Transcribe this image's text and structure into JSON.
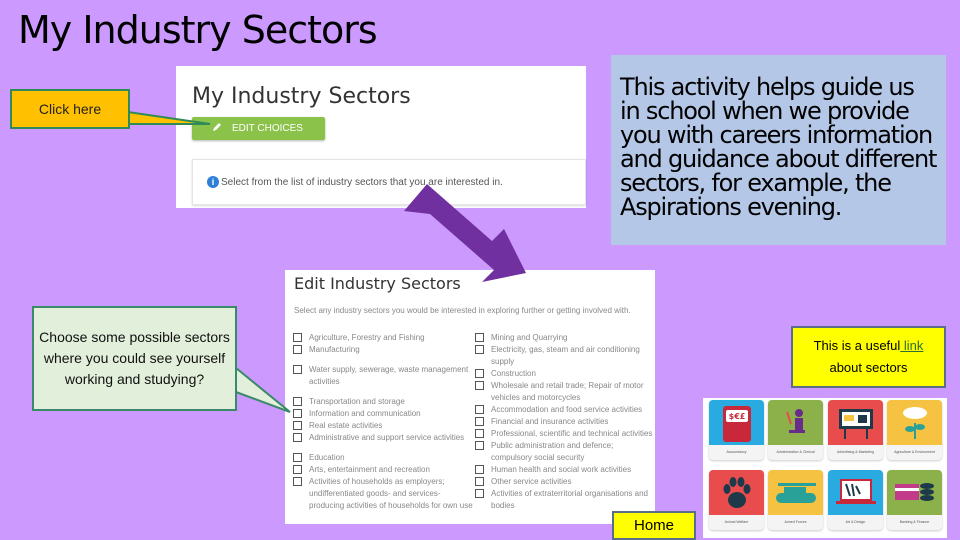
{
  "slide": {
    "title": "My Industry Sectors",
    "colors": {
      "background": "#cc99ff",
      "arrow": "#7030a0",
      "click_callout": "#ffc000",
      "link_box": "#ffff00",
      "info_box": "#b4c7e7",
      "edit_button": "#8bc34a"
    }
  },
  "click_callout": {
    "label": "Click here"
  },
  "screenshot_top": {
    "heading": "My Industry Sectors",
    "edit_button": {
      "icon": "pencil-icon",
      "label": "EDIT CHOICES"
    },
    "info": {
      "icon": "info-icon",
      "text": "Select from the list of industry sectors that you are interested in."
    }
  },
  "explanation": {
    "text": "This activity helps guide us in school when we provide you with careers information and guidance about different sectors, for example, the Aspirations evening."
  },
  "screenshot_edit": {
    "heading": "Edit Industry Sectors",
    "intro": "Select any industry sectors you would be interested in exploring further or getting involved with.",
    "left_options": [
      "Agriculture, Forestry and Fishing",
      "Manufacturing",
      "Water supply, sewerage, waste management activities",
      "Transportation and storage",
      "Information and communication",
      "Real estate activities",
      "Administrative and support service activities",
      "Education",
      "Arts, entertainment and recreation",
      "Activities of households as employers; undifferentiated goods- and services-producing activities of households for own use"
    ],
    "right_options": [
      "Mining and Quarrying",
      "Electricity, gas, steam and air conditioning supply",
      "Construction",
      "Wholesale and retail trade; Repair of motor vehicles and motorcycles",
      "Accommodation and food service activities",
      "Financial and insurance activities",
      "Professional, scientific and technical activities",
      "Public administration and defence; compulsory social security",
      "Human health and social work activities",
      "Other service activities",
      "Activities of extraterritorial organisations and bodies"
    ]
  },
  "choose_callout": {
    "text": "Choose some possible sectors where you could see yourself working and studying?"
  },
  "link_box": {
    "prefix": "This is a useful",
    "link_text": " link",
    "suffix": "about sectors"
  },
  "sector_cards": [
    {
      "label": "Accountancy",
      "icon": "currency-icon",
      "color": "#29abe2"
    },
    {
      "label": "Administration & Clerical",
      "icon": "desk-worker-icon",
      "color": "#8cb04a"
    },
    {
      "label": "Advertising & Marketing",
      "icon": "billboard-icon",
      "color": "#e84c4c"
    },
    {
      "label": "Agriculture & Environment",
      "icon": "plant-rain-icon",
      "color": "#f5c242"
    },
    {
      "label": "Animal Welfare",
      "icon": "paw-icon",
      "color": "#e84c4c"
    },
    {
      "label": "Armed Forces",
      "icon": "tank-icon",
      "color": "#f5c242"
    },
    {
      "label": "Art & Design",
      "icon": "art-laptop-icon",
      "color": "#29abe2"
    },
    {
      "label": "Banking & Finance",
      "icon": "coins-card-icon",
      "color": "#8cb04a"
    }
  ],
  "home_button": {
    "label": "Home"
  }
}
